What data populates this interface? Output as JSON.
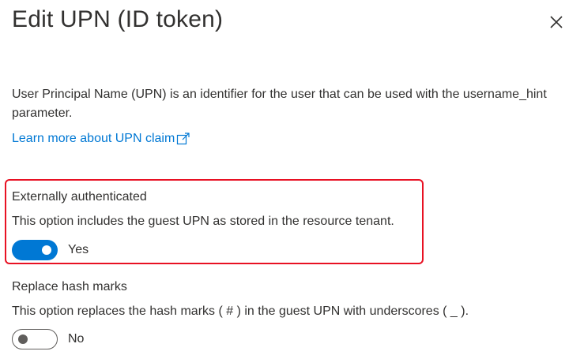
{
  "panel": {
    "title": "Edit UPN (ID token)",
    "description": "User Principal Name (UPN) is an identifier for the user that can be used with the username_hint parameter.",
    "learn_more": "Learn more about UPN claim"
  },
  "options": [
    {
      "label": "Externally authenticated",
      "description": "This option includes the guest UPN as stored in the resource tenant.",
      "value": "Yes",
      "on": true
    },
    {
      "label": "Replace hash marks",
      "description": "This option replaces the hash marks ( # ) in the guest UPN with underscores ( _ ).",
      "value": "No",
      "on": false
    }
  ],
  "colors": {
    "accent": "#0078d4",
    "highlight_border": "#e81123",
    "text": "#323130"
  },
  "icons": {
    "close": "close-icon",
    "external_link": "external-link-icon"
  }
}
